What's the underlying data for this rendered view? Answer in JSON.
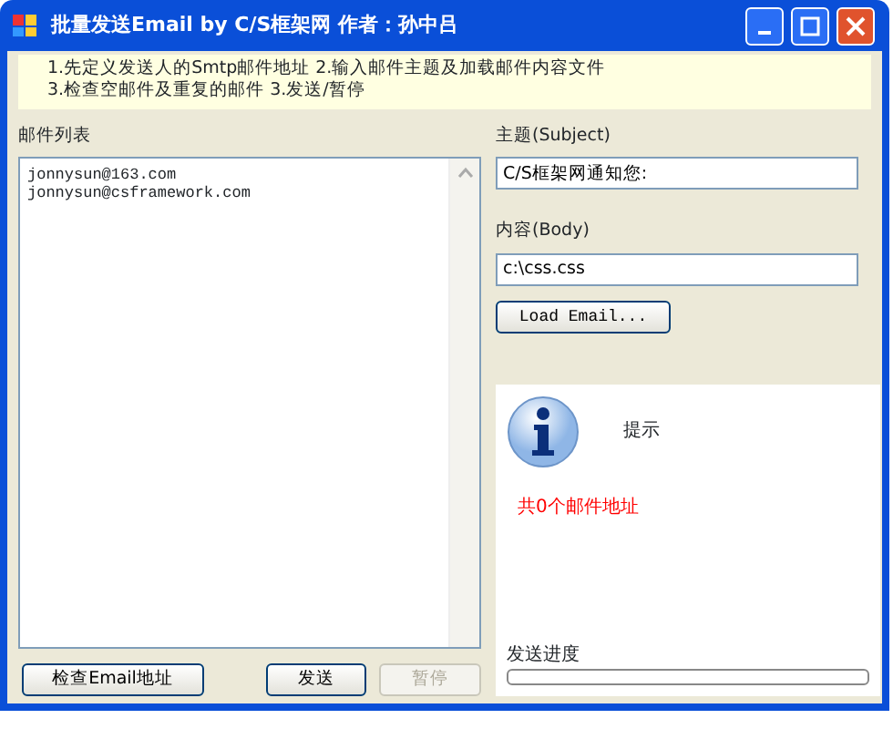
{
  "window": {
    "title": "批量发送Email by C/S框架网 作者：孙中吕"
  },
  "instructions": [
    "1.先定义发送人的Smtp邮件地址 2.输入邮件主题及加载邮件内容文件",
    "3.检查空邮件及重复的邮件 3.发送/暂停"
  ],
  "email_list": {
    "label": "邮件列表",
    "items": [
      "jonnysun@163.com",
      "jonnysun@csframework.com"
    ]
  },
  "subject": {
    "label": "主题(Subject)",
    "value": "C/S框架网通知您:"
  },
  "body": {
    "label": "内容(Body)",
    "value": "c:\\css.css"
  },
  "load_button": {
    "label": "Load Email..."
  },
  "info_panel": {
    "title": "提示",
    "message": "共0个邮件地址",
    "progress_label": "发送进度",
    "progress": {
      "level": 0
    }
  },
  "buttons": [
    {
      "label": "检查Email地址",
      "disabled": false
    },
    {
      "label": "发送",
      "disabled": false
    },
    {
      "label": "暂停",
      "disabled": true
    }
  ]
}
